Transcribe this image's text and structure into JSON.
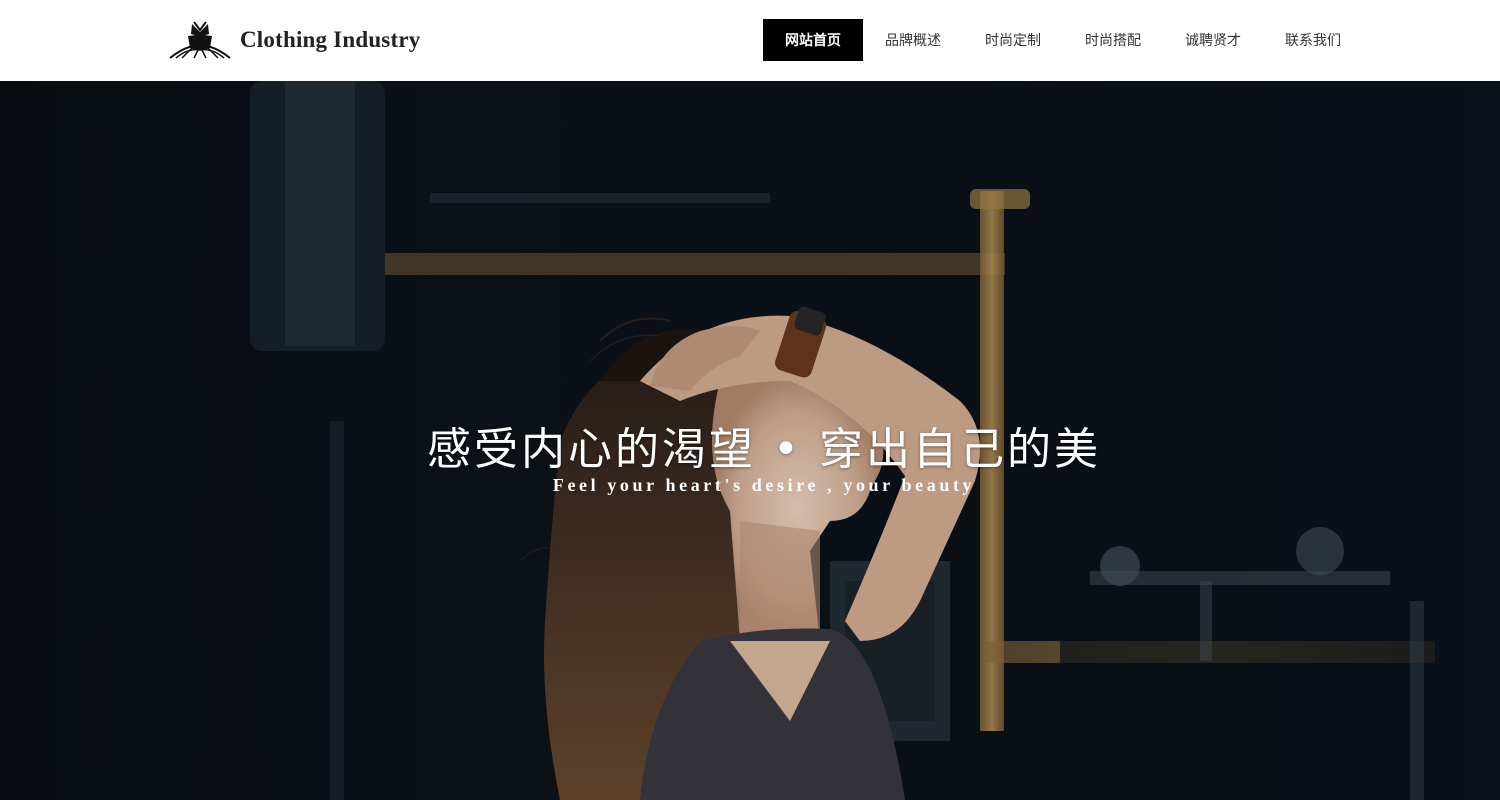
{
  "header": {
    "logo_text": "Clothing Industry",
    "logo_icon": "hanger-bow-icon",
    "nav": [
      {
        "label": "网站首页",
        "active": true
      },
      {
        "label": "品牌概述",
        "active": false
      },
      {
        "label": "时尚定制",
        "active": false
      },
      {
        "label": "时尚搭配",
        "active": false
      },
      {
        "label": "诚聘贤才",
        "active": false
      },
      {
        "label": "联系我们",
        "active": false
      }
    ]
  },
  "hero": {
    "title": "感受内心的渴望 • 穿出自己的美",
    "subtitle": "Feel your heart's desire , your beauty"
  },
  "colors": {
    "header_bg": "#ffffff",
    "nav_active_bg": "#000000",
    "nav_active_text": "#ffffff",
    "nav_text": "#333333",
    "hero_text": "#ffffff"
  }
}
